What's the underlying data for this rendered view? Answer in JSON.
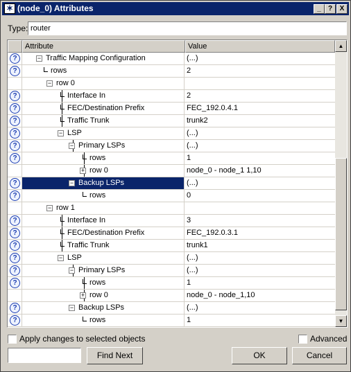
{
  "window": {
    "title": "(node_0) Attributes",
    "controls": {
      "help": "?",
      "close": "X"
    }
  },
  "type": {
    "label": "Type:",
    "value": "router"
  },
  "grid": {
    "headers": {
      "attribute": "Attribute",
      "value": "Value"
    },
    "rows": [
      {
        "label": "Traffic Mapping Configuration",
        "value": "(...)",
        "help": true
      },
      {
        "label": "rows",
        "value": "2",
        "help": true
      },
      {
        "label": "row 0",
        "value": "",
        "help": false
      },
      {
        "label": "Interface In",
        "value": "2",
        "help": true
      },
      {
        "label": "FEC/Destination Prefix",
        "value": "FEC_192.0.4.1",
        "help": true
      },
      {
        "label": "Traffic Trunk",
        "value": "trunk2",
        "help": true
      },
      {
        "label": "LSP",
        "value": "(...)",
        "help": true
      },
      {
        "label": "Primary LSPs",
        "value": "(...)",
        "help": true
      },
      {
        "label": "rows",
        "value": "1",
        "help": true
      },
      {
        "label": "row 0",
        "value": "node_0 - node_1 1,10",
        "help": false
      },
      {
        "label": "Backup LSPs",
        "value": "(...)",
        "help": true
      },
      {
        "label": "rows",
        "value": "0",
        "help": true
      },
      {
        "label": "row 1",
        "value": "",
        "help": false
      },
      {
        "label": "Interface In",
        "value": "3",
        "help": true
      },
      {
        "label": "FEC/Destination Prefix",
        "value": "FEC_192.0.3.1",
        "help": true
      },
      {
        "label": "Traffic Trunk",
        "value": "trunk1",
        "help": true
      },
      {
        "label": "LSP",
        "value": "(...)",
        "help": true
      },
      {
        "label": "Primary LSPs",
        "value": "(...)",
        "help": true
      },
      {
        "label": "rows",
        "value": "1",
        "help": true
      },
      {
        "label": "row 0",
        "value": "node_0 - node_1,10",
        "help": false
      },
      {
        "label": "Backup LSPs",
        "value": "(...)",
        "help": true
      },
      {
        "label": "rows",
        "value": "1",
        "help": true
      }
    ]
  },
  "options": {
    "apply": "Apply changes to selected objects",
    "advanced": "Advanced"
  },
  "buttons": {
    "find_next": "Find Next",
    "ok": "OK",
    "cancel": "Cancel"
  }
}
